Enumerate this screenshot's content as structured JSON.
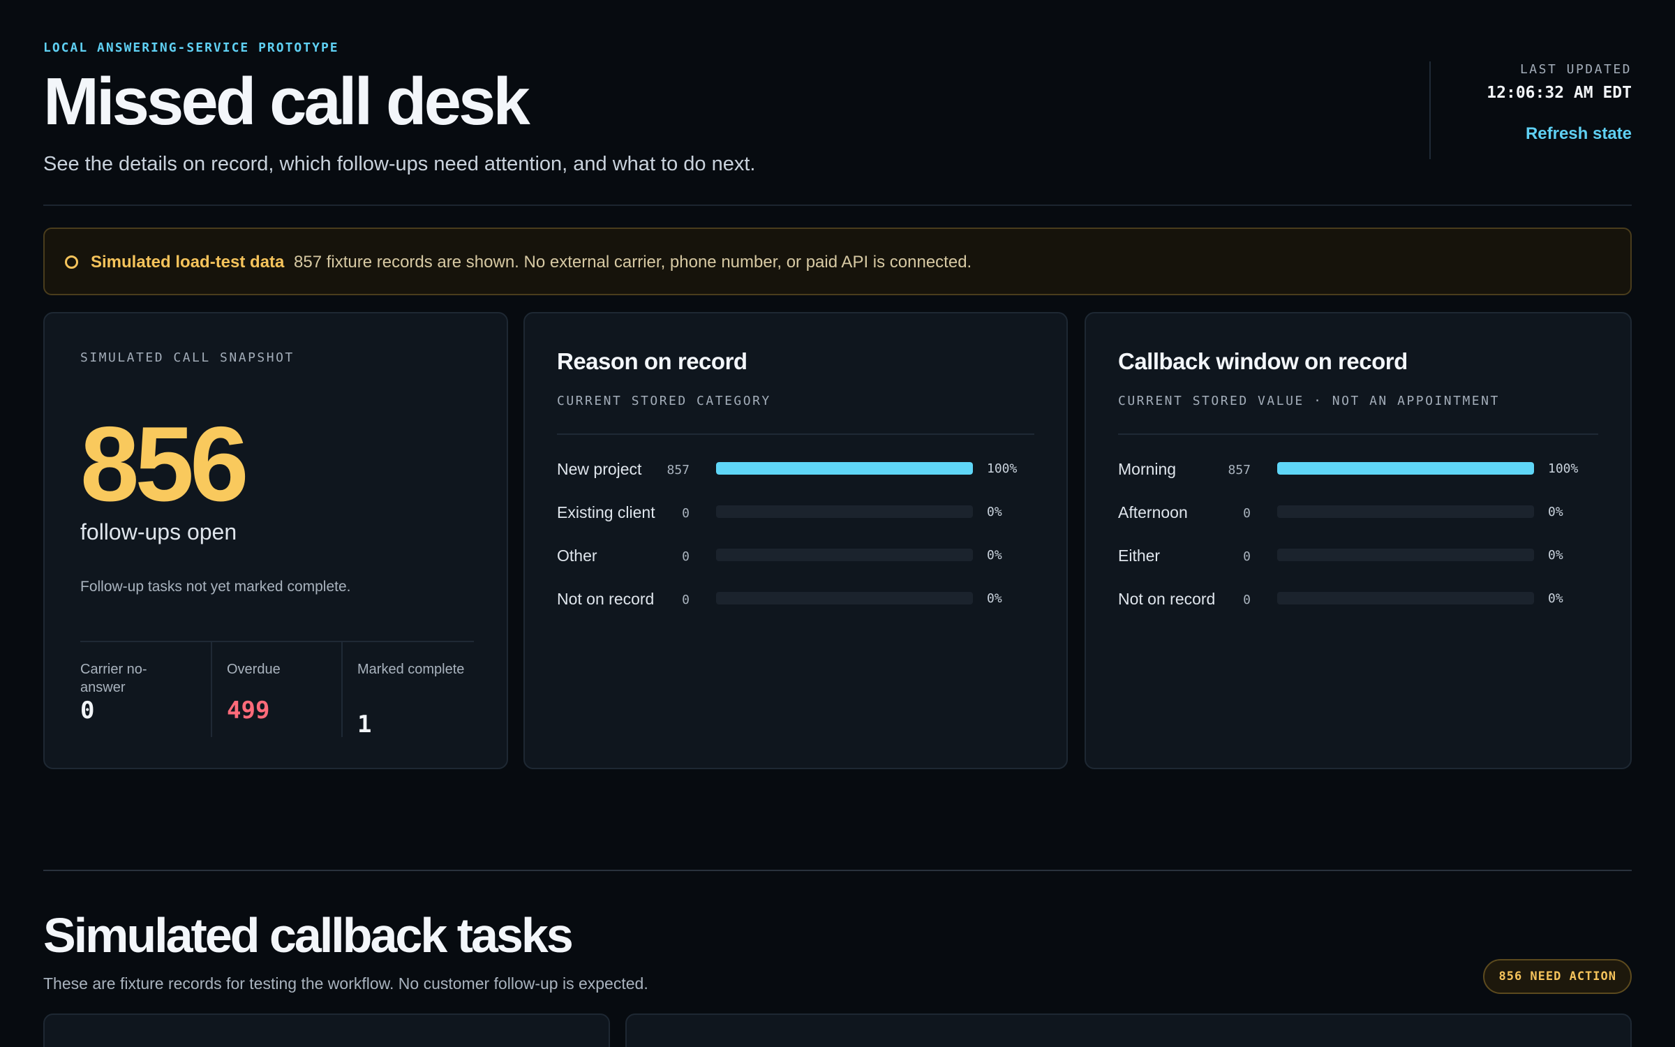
{
  "header": {
    "eyebrow": "LOCAL ANSWERING-SERVICE PROTOTYPE",
    "title": "Missed call desk",
    "subtitle": "See the details on record, which follow-ups need attention, and what to do next.",
    "last_updated_label": "LAST UPDATED",
    "last_updated_time": "12:06:32 AM EDT",
    "refresh_label": "Refresh state"
  },
  "banner": {
    "title": "Simulated load-test data",
    "text": "857 fixture records are shown. No external carrier, phone number, or paid API is connected.",
    "accent": "#f5c35b"
  },
  "snapshot": {
    "label": "SIMULATED CALL SNAPSHOT",
    "number": "856",
    "unit": "follow-ups open",
    "description": "Follow-up tasks not yet marked complete.",
    "stats": [
      {
        "label": "Carrier no-answer",
        "value": "0"
      },
      {
        "label": "Overdue",
        "value": "499"
      },
      {
        "label": "Marked complete",
        "value": "1"
      }
    ]
  },
  "reason": {
    "title": "Reason on record",
    "subtitle": "CURRENT STORED CATEGORY",
    "rows": [
      {
        "label": "New project",
        "count": "857",
        "pct": "100%",
        "fraction": 1.0
      },
      {
        "label": "Existing client",
        "count": "0",
        "pct": "0%",
        "fraction": 0
      },
      {
        "label": "Other",
        "count": "0",
        "pct": "0%",
        "fraction": 0
      },
      {
        "label": "Not on record",
        "count": "0",
        "pct": "0%",
        "fraction": 0
      }
    ]
  },
  "callback": {
    "title": "Callback window on record",
    "subtitle": "CURRENT STORED VALUE · NOT AN APPOINTMENT",
    "rows": [
      {
        "label": "Morning",
        "count": "857",
        "pct": "100%",
        "fraction": 1.0
      },
      {
        "label": "Afternoon",
        "count": "0",
        "pct": "0%",
        "fraction": 0
      },
      {
        "label": "Either",
        "count": "0",
        "pct": "0%",
        "fraction": 0
      },
      {
        "label": "Not on record",
        "count": "0",
        "pct": "0%",
        "fraction": 0
      }
    ]
  },
  "tasks_section": {
    "title": "Simulated callback tasks",
    "subtitle": "These are fixture records for testing the workflow. No customer follow-up is expected.",
    "badge": "856 NEED ACTION"
  },
  "colors": {
    "background": "#070b10",
    "accent_cyan": "#5fd0f3",
    "accent_yellow": "#f9c95d",
    "overdue_red": "#ff6b7a"
  }
}
